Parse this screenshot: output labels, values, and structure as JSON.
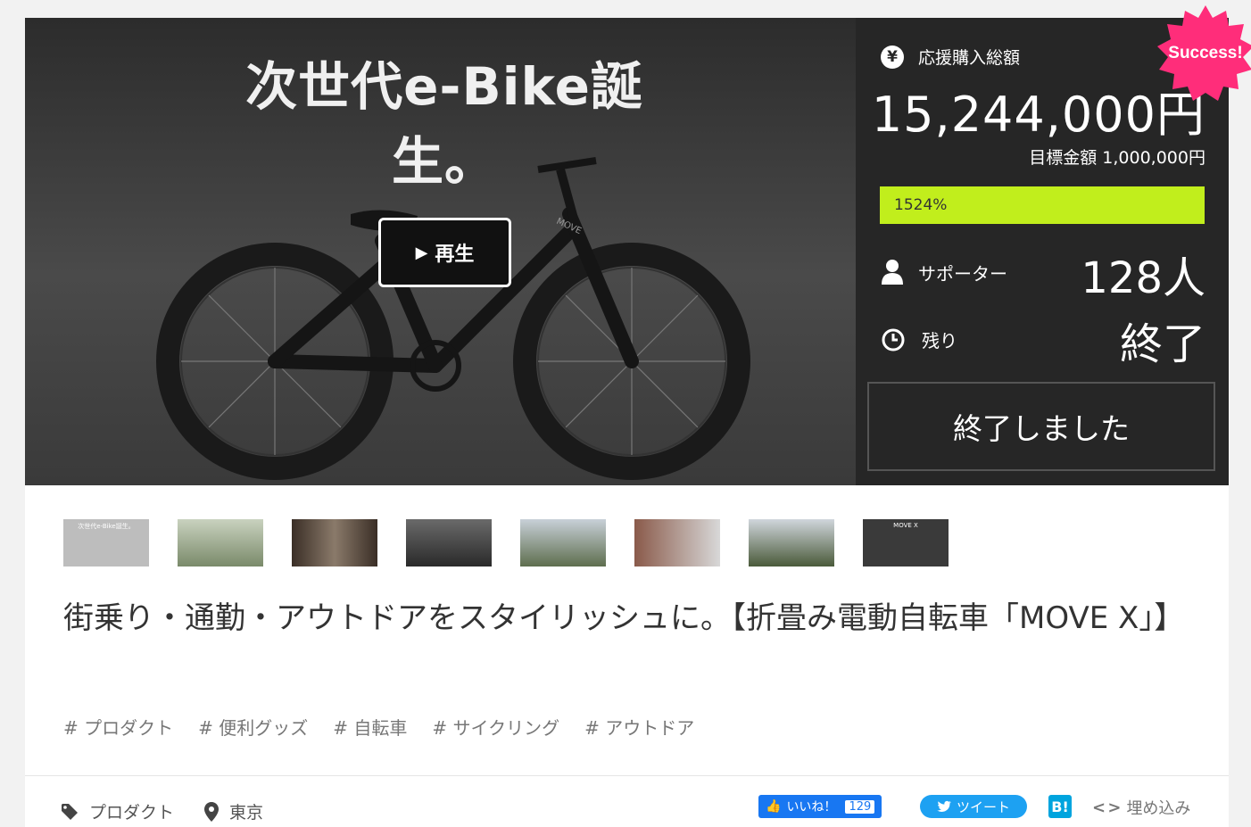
{
  "hero": {
    "title": "次世代e-Bike誕生。",
    "bike_brand": "MOVE",
    "play_label": "再生"
  },
  "stats": {
    "total_label": "応援購入総額",
    "total_amount": "15,244,000円",
    "goal_label": "目標金額 1,000,000円",
    "progress_text": "1524%",
    "progress_fraction": 1.0,
    "supporters_label": "サポーター",
    "supporters_value": "128人",
    "remaining_label": "残り",
    "remaining_value": "終了",
    "ended_button": "終了しました",
    "badge": "Success!",
    "colors": {
      "panel": "#262626",
      "progress": "#c1ee1c",
      "badge": "#ff2d7a"
    }
  },
  "thumbnails": [
    {
      "caption": "次世代e-Bike誕生。",
      "bg": "#bdbdbd"
    },
    {
      "caption": "",
      "bg": "#7a8a6a"
    },
    {
      "caption": "",
      "bg": "#6b5a4a"
    },
    {
      "caption": "",
      "bg": "#4a4a4a"
    },
    {
      "caption": "",
      "bg": "#5e6e4e"
    },
    {
      "caption": "",
      "bg": "#7a6a5a"
    },
    {
      "caption": "",
      "bg": "#5a6a4a"
    },
    {
      "caption": "MOVE X",
      "bg": "#3a3a3a"
    }
  ],
  "project": {
    "title": "街乗り・通勤・アウトドアをスタイリッシュに。【折畳み電動自転車「MOVE X」】",
    "tags": [
      "# プロダクト",
      "# 便利グッズ",
      "# 自転車",
      "# サイクリング",
      "# アウトドア"
    ]
  },
  "footer": {
    "category": "プロダクト",
    "location": "東京",
    "like_label": "いいね！",
    "like_count": "129",
    "tweet_label": "ツイート",
    "hatena_label": "B!",
    "embed_label": "埋め込み"
  }
}
